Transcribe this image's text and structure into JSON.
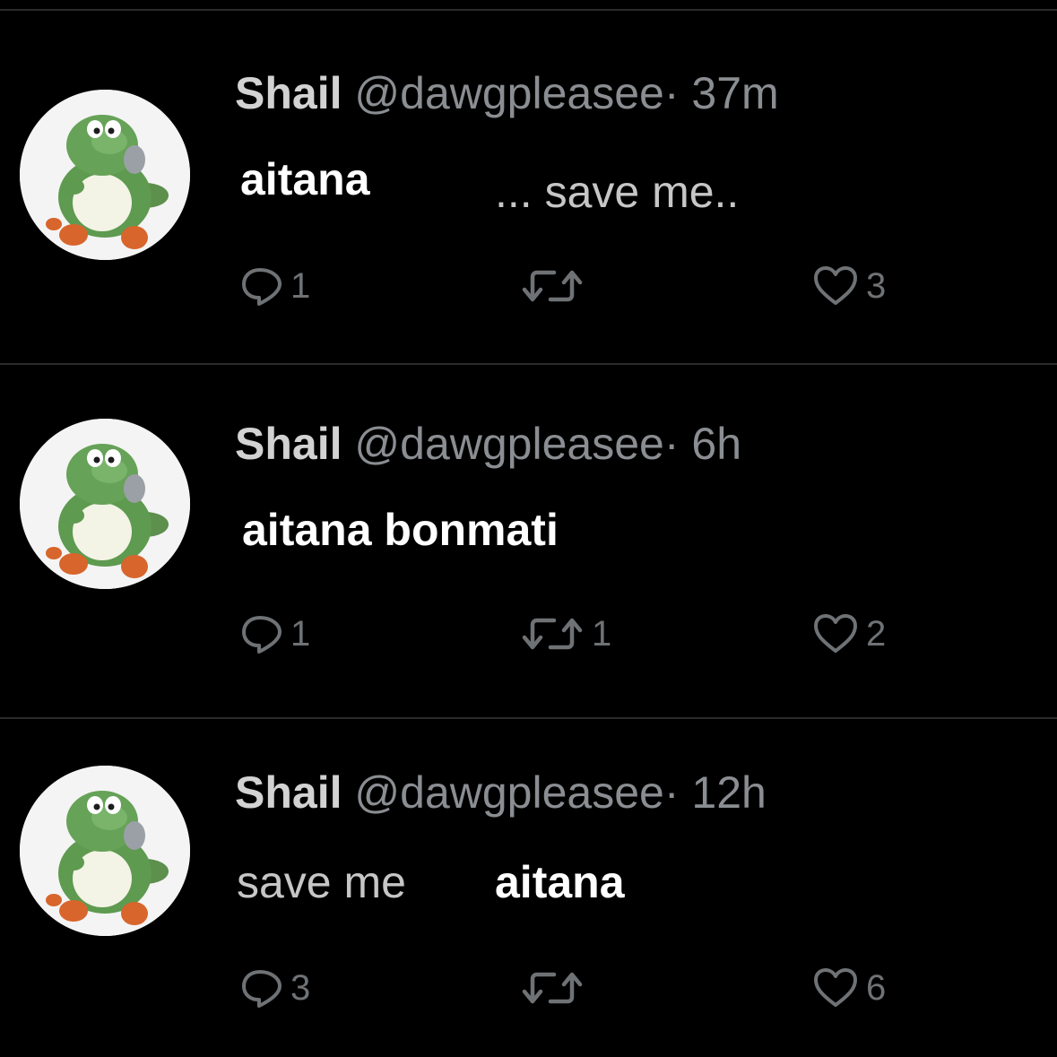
{
  "tweets": [
    {
      "display_name": "Shail",
      "handle": "@dawgpleasee",
      "separator": "·",
      "time": "37m",
      "text_overlay": "aitana",
      "text_plain": "... save me..",
      "reply_count": "1",
      "retweet_count": "",
      "like_count": "3"
    },
    {
      "display_name": "Shail",
      "handle": "@dawgpleasee",
      "separator": "·",
      "time": "6h",
      "text_overlay": "aitana bonmati",
      "text_plain": "",
      "reply_count": "1",
      "retweet_count": "1",
      "like_count": "2"
    },
    {
      "display_name": "Shail",
      "handle": "@dawgpleasee",
      "separator": "·",
      "time": "12h",
      "text_plain": "save me",
      "text_overlay": "aitana",
      "reply_count": "3",
      "retweet_count": "",
      "like_count": "6"
    }
  ],
  "icons": {
    "avatar": "green-dinosaur-avatar",
    "reply": "speech-bubble-icon",
    "retweet": "retweet-arrows-icon",
    "like": "heart-outline-icon"
  },
  "colors": {
    "background": "#000000",
    "display_name": "#d2d2d2",
    "secondary_text": "#8a8d91",
    "overlay_text": "#ffffff",
    "action_icons": "#6f7275"
  }
}
